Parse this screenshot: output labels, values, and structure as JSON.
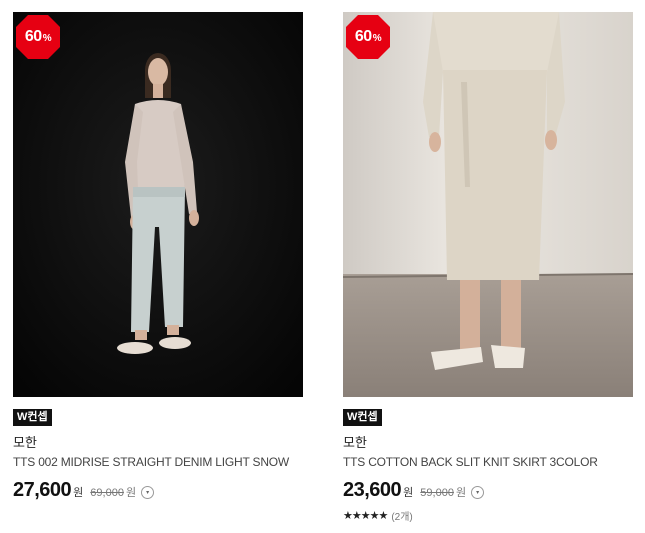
{
  "products": [
    {
      "discount": "60",
      "discount_unit": "%",
      "tag": "W컨셉",
      "brand": "모한",
      "name": "TTS 002 MIDRISE STRAIGHT DENIM LIGHT SNOW",
      "price": "27,600",
      "currency": "원",
      "original_price": "69,000",
      "original_currency": "원",
      "photo_icon": "model-in-denim-photo",
      "badge_color": "#e60012"
    },
    {
      "discount": "60",
      "discount_unit": "%",
      "tag": "W컨셉",
      "brand": "모한",
      "name": "TTS COTTON BACK SLIT KNIT SKIRT 3COLOR",
      "price": "23,600",
      "currency": "원",
      "original_price": "59,000",
      "original_currency": "원",
      "stars": "★★★★★",
      "review_count": "(2개)",
      "photo_icon": "model-in-knit-skirt-photo",
      "badge_color": "#e60012"
    }
  ]
}
